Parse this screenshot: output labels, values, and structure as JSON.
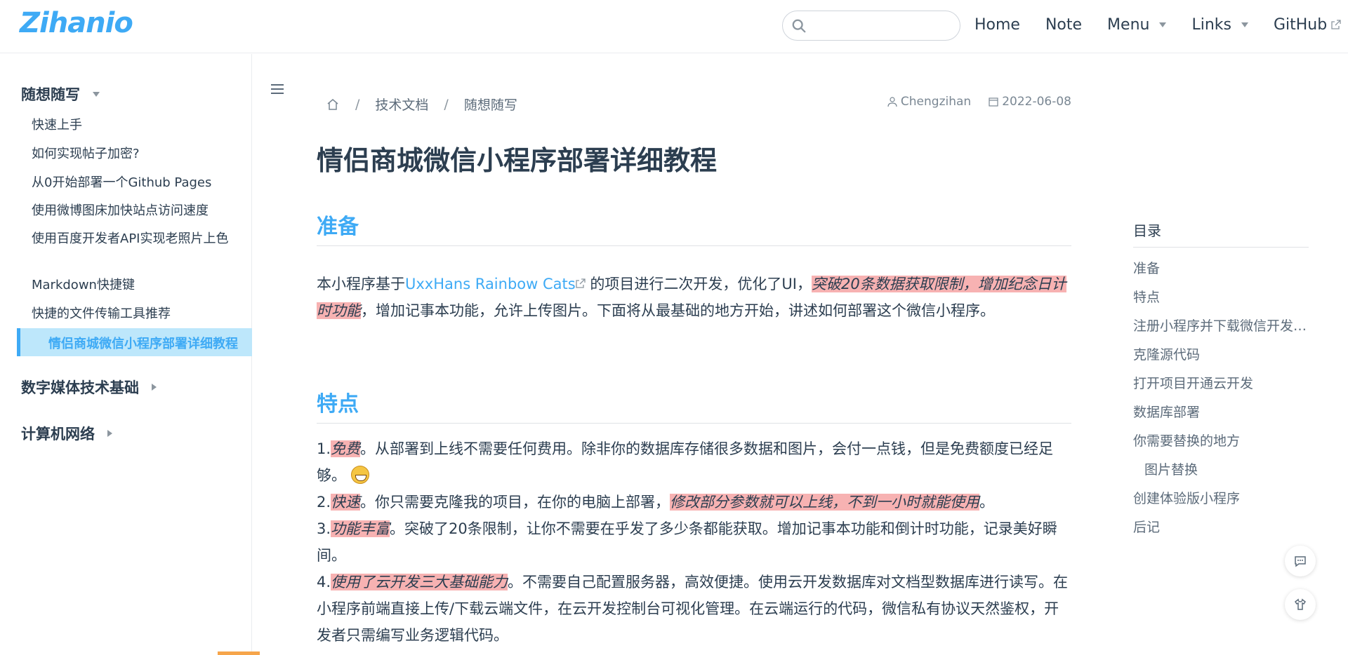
{
  "navbar": {
    "logo": "Zihanio",
    "search_placeholder": "",
    "items": [
      {
        "label": "Home",
        "dropdown": false,
        "external": false
      },
      {
        "label": "Note",
        "dropdown": false,
        "external": false
      },
      {
        "label": "Menu",
        "dropdown": true,
        "external": false
      },
      {
        "label": "Links",
        "dropdown": true,
        "external": false
      },
      {
        "label": "GitHub",
        "dropdown": false,
        "external": true
      }
    ]
  },
  "sidebar": {
    "groups": [
      {
        "title": "随想随写",
        "expanded": true
      },
      {
        "title": "数字媒体技术基础",
        "expanded": false
      },
      {
        "title": "计算机网络",
        "expanded": false
      }
    ],
    "items": [
      "快速上手",
      "如何实现帖子加密?",
      "从0开始部署一个Github Pages",
      "使用微博图床加快站点访问速度",
      "使用百度开发者API实现老照片上色",
      "Markdown快捷键",
      "快捷的文件传输工具推荐"
    ],
    "active_item": "情侣商城微信小程序部署详细教程"
  },
  "breadcrumb": [
    "技术文档",
    "随想随写"
  ],
  "meta": {
    "author": "Chengzihan",
    "date": "2022-06-08"
  },
  "page_title": "情侣商城微信小程序部署详细教程",
  "sections": {
    "prep": {
      "heading": "准备",
      "p_before_link": "本小程序基于",
      "link_text": "UxxHans Rainbow Cats",
      "p_after_link": " 的项目进行二次开发，优化了UI，",
      "highlight": "突破20条数据获取限制，增加纪念日计时功能",
      "p_tail": "，增加记事本功能，允许上传图片。下面将从最基础的地方开始，讲述如何部署这个微信小程序。"
    },
    "features": {
      "heading": "特点",
      "f1_num": "1.",
      "f1_hl": "免费",
      "f1_text": "。从部署到上线不需要任何费用。除非你的数据库存储很多数据和图片，会付一点钱，但是免费额度已经足够。",
      "f2_num": "2.",
      "f2_hl": "快速",
      "f2_text": "。你只需要克隆我的项目，在你的电脑上部署，",
      "f2_hl2": "修改部分参数就可以上线，不到一小时就能使用",
      "f2_end": "。",
      "f3_num": "3.",
      "f3_hl": "功能丰富",
      "f3_text": "。突破了20条限制，让你不需要在乎发了多少条都能获取。增加记事本功能和倒计时功能，记录美好瞬间。",
      "f4_num": "4.",
      "f4_hl": "使用了云开发三大基础能力",
      "f4_text": "。不需要自己配置服务器，高效便捷。使用云开发数据库对文档型数据库进行读写。在小程序前端直接上传/下载云端文件，在云开发控制台可视化管理。在云端运行的代码，微信私有协议天然鉴权，开发者只需编写业务逻辑代码。"
    }
  },
  "toc": {
    "title": "目录",
    "items": [
      "准备",
      "特点",
      "注册小程序并下载微信开发者工具",
      "克隆源代码",
      "打开项目开通云开发",
      "数据库部署",
      "你需要替换的地方",
      "图片替换",
      "创建体验版小程序",
      "后记"
    ]
  },
  "icons": {
    "search": "search-icon",
    "home": "home-icon",
    "author": "user-icon",
    "date": "calendar-icon",
    "comment": "comment-icon",
    "theme": "shirt-icon"
  },
  "colors": {
    "accent": "#3eaaf5",
    "highlight": "#f7b2b2",
    "text": "#2c3e50"
  }
}
